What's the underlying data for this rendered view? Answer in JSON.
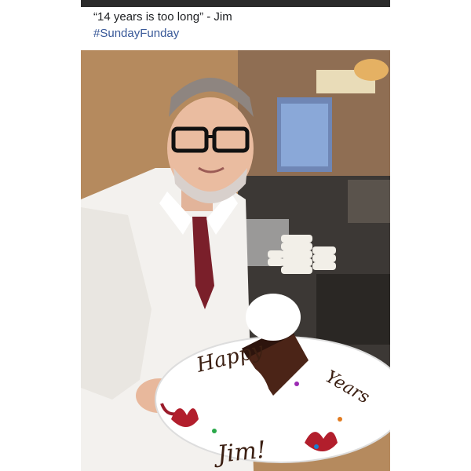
{
  "post": {
    "caption": "“14 years is too long” - Jim",
    "hashtag": "#SundayFunday"
  },
  "photo": {
    "plate_text_left": "Happy",
    "plate_text_right": "Years",
    "plate_text_bottom": "Jim!"
  },
  "colors": {
    "hashtag": "#385898",
    "caption": "#1c1e21",
    "top_bar": "#2b2b2b"
  }
}
